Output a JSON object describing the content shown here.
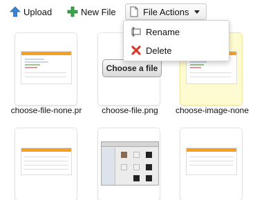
{
  "toolbar": {
    "upload_label": "Upload",
    "new_file_label": "New File",
    "file_actions_label": "File Actions"
  },
  "menu": {
    "items": [
      {
        "label": "Rename",
        "icon": "rename-icon"
      },
      {
        "label": "Delete",
        "icon": "delete-icon"
      }
    ]
  },
  "files": [
    {
      "name": "choose-file-none.pr"
    },
    {
      "name": "choose-file.png",
      "preview_text": "Choose a file"
    },
    {
      "name": "choose-image-none"
    }
  ],
  "colors": {
    "accent_orange": "#f6a023",
    "upload_blue": "#3a86d6",
    "new_green": "#3aa64a",
    "delete_red": "#d23a2a",
    "selected_bg": "#fffbd0"
  }
}
